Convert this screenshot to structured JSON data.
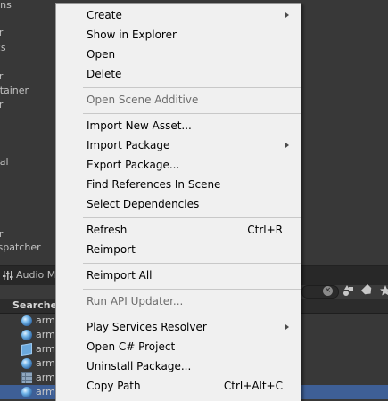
{
  "hierarchy": {
    "items": [
      "tions",
      "ller",
      "sics",
      "al",
      "ller",
      "ontainer",
      "ller",
      "onal",
      "ller",
      "Dispatcher"
    ]
  },
  "audio_tab": {
    "label": "Audio M"
  },
  "results": {
    "title": "Searche",
    "rows": [
      {
        "name": "arm",
        "icon": "sphere-icon"
      },
      {
        "name": "arm",
        "icon": "sphere-icon"
      },
      {
        "name": "arm",
        "icon": "cube-icon"
      },
      {
        "name": "arm",
        "icon": "sphere-icon"
      },
      {
        "name": "arm",
        "icon": "grid-icon"
      },
      {
        "name": "arm",
        "icon": "sphere-icon"
      }
    ]
  },
  "menu": {
    "items": [
      {
        "label": "Create",
        "shortcut": "",
        "submenu": true,
        "disabled": false
      },
      {
        "label": "Show in Explorer",
        "shortcut": "",
        "submenu": false,
        "disabled": false
      },
      {
        "label": "Open",
        "shortcut": "",
        "submenu": false,
        "disabled": false
      },
      {
        "label": "Delete",
        "shortcut": "",
        "submenu": false,
        "disabled": false
      },
      {
        "label": "Open Scene Additive",
        "shortcut": "",
        "submenu": false,
        "disabled": true
      },
      {
        "label": "Import New Asset...",
        "shortcut": "",
        "submenu": false,
        "disabled": false
      },
      {
        "label": "Import Package",
        "shortcut": "",
        "submenu": true,
        "disabled": false
      },
      {
        "label": "Export Package...",
        "shortcut": "",
        "submenu": false,
        "disabled": false
      },
      {
        "label": "Find References In Scene",
        "shortcut": "",
        "submenu": false,
        "disabled": false
      },
      {
        "label": "Select Dependencies",
        "shortcut": "",
        "submenu": false,
        "disabled": false
      },
      {
        "label": "Refresh",
        "shortcut": "Ctrl+R",
        "submenu": false,
        "disabled": false
      },
      {
        "label": "Reimport",
        "shortcut": "",
        "submenu": false,
        "disabled": false
      },
      {
        "label": "Reimport All",
        "shortcut": "",
        "submenu": false,
        "disabled": false
      },
      {
        "label": "Run API Updater...",
        "shortcut": "",
        "submenu": false,
        "disabled": true
      },
      {
        "label": "Play Services Resolver",
        "shortcut": "",
        "submenu": true,
        "disabled": false
      },
      {
        "label": "Open C# Project",
        "shortcut": "",
        "submenu": false,
        "disabled": false
      },
      {
        "label": "Uninstall Package...",
        "shortcut": "",
        "submenu": false,
        "disabled": false
      },
      {
        "label": "Copy Path",
        "shortcut": "Ctrl+Alt+C",
        "submenu": false,
        "disabled": false
      }
    ]
  },
  "colors": {
    "menu_background": "#f0f0f0",
    "selection": "#3e5f96",
    "editor_background": "#383838"
  }
}
